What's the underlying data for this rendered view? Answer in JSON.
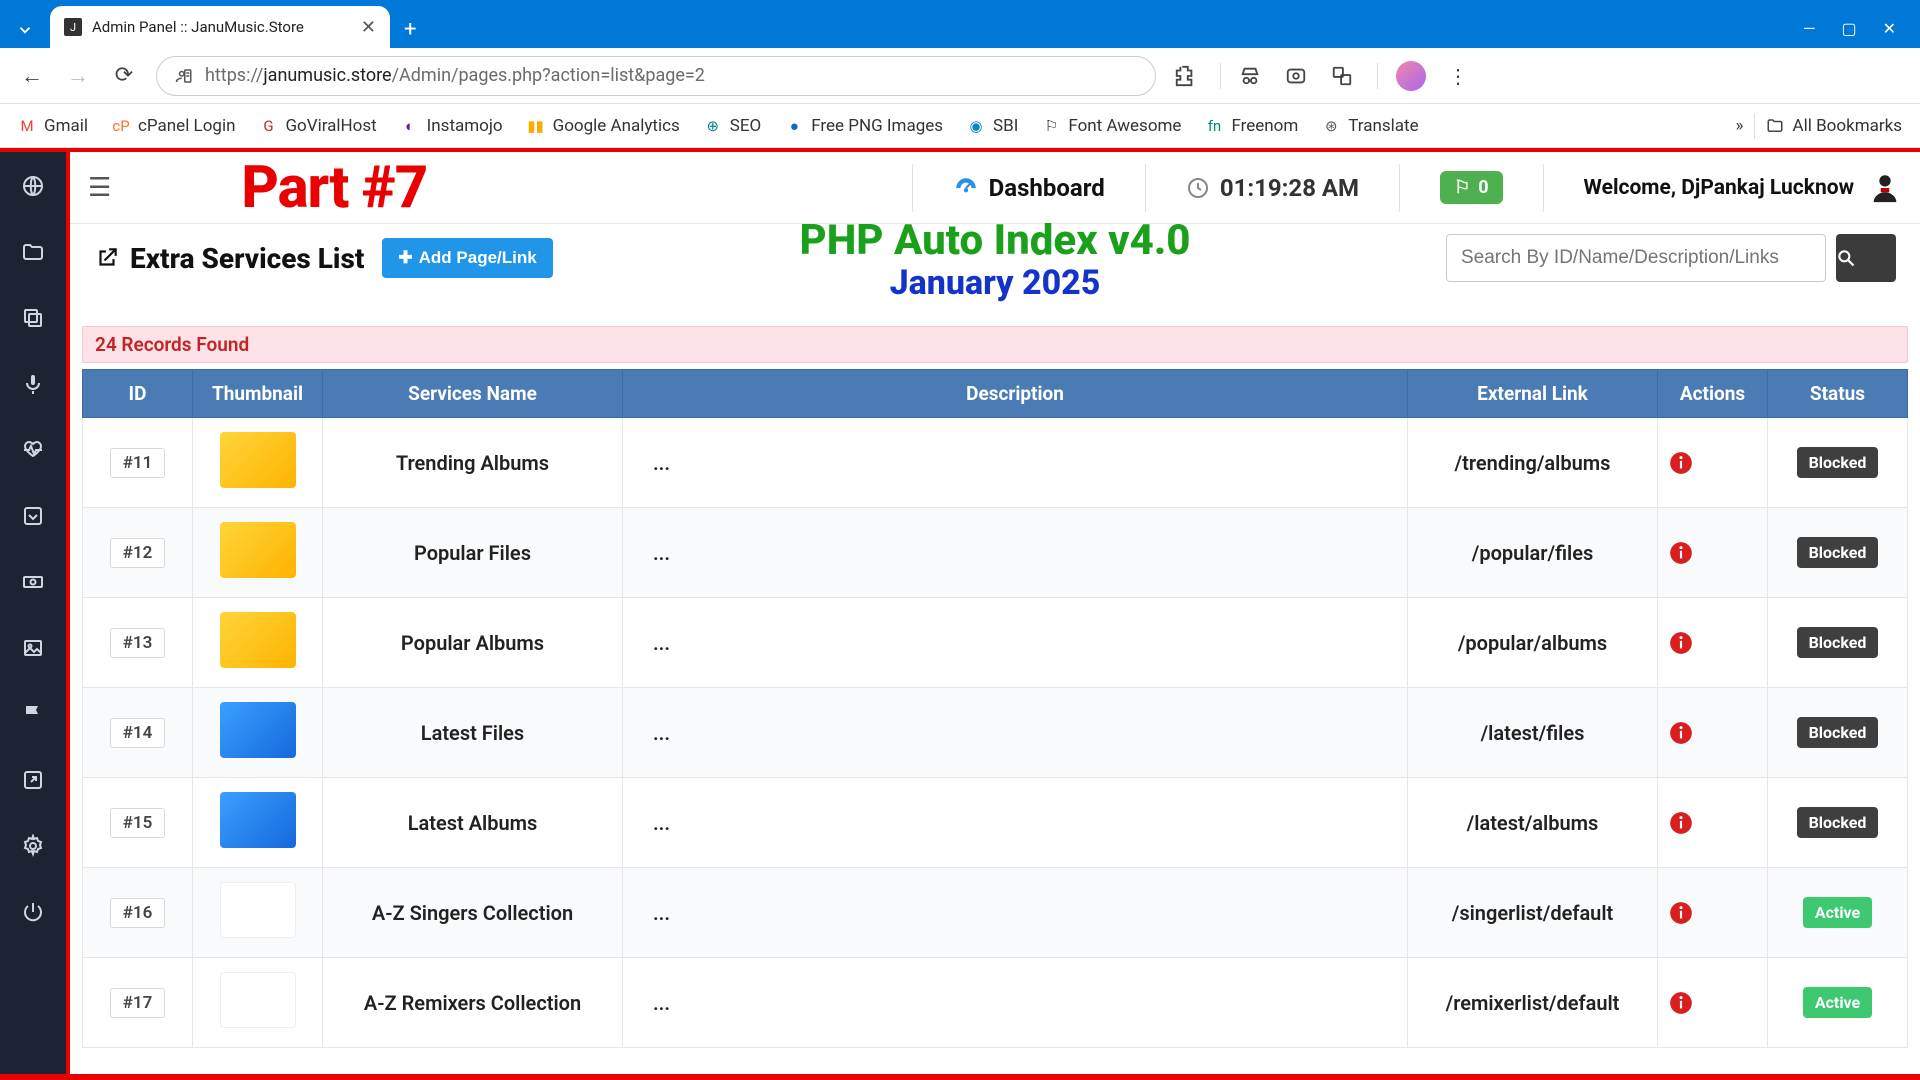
{
  "browser": {
    "tab_title": "Admin Panel :: JanuMusic.Store",
    "url_prefix": "https://",
    "url_host": "janumusic.store",
    "url_path": "/Admin/pages.php?action=list&page=2"
  },
  "bookmarks": [
    {
      "label": "Gmail"
    },
    {
      "label": "cPanel Login"
    },
    {
      "label": "GoViralHost"
    },
    {
      "label": "Instamojo"
    },
    {
      "label": "Google Analytics"
    },
    {
      "label": "SEO"
    },
    {
      "label": "Free PNG Images"
    },
    {
      "label": "SBI"
    },
    {
      "label": "Font Awesome"
    },
    {
      "label": "Freenom"
    },
    {
      "label": "Translate"
    }
  ],
  "bookmarks_more": "»",
  "all_bookmarks_label": "All Bookmarks",
  "overlay": {
    "part": "Part #7",
    "title": "PHP Auto Index v4.0",
    "subtitle": "January 2025"
  },
  "topbar": {
    "dashboard": "Dashboard",
    "time": "01:19:28 AM",
    "flag_count": "0",
    "welcome": "Welcome, DjPankaj Lucknow"
  },
  "page": {
    "title": "Extra Services List",
    "add_button": "Add Page/Link",
    "search_placeholder": "Search By ID/Name/Description/Links",
    "records_found": "24 Records Found"
  },
  "table": {
    "headers": {
      "id": "ID",
      "thumbnail": "Thumbnail",
      "name": "Services Name",
      "description": "Description",
      "link": "External Link",
      "actions": "Actions",
      "status": "Status"
    },
    "rows": [
      {
        "id": "#11",
        "thumb": "y",
        "name": "Trending Albums",
        "description": "...",
        "link": "/trending/albums",
        "status": "Blocked"
      },
      {
        "id": "#12",
        "thumb": "y",
        "name": "Popular Files",
        "description": "...",
        "link": "/popular/files",
        "status": "Blocked"
      },
      {
        "id": "#13",
        "thumb": "y",
        "name": "Popular Albums",
        "description": "...",
        "link": "/popular/albums",
        "status": "Blocked"
      },
      {
        "id": "#14",
        "thumb": "b",
        "name": "Latest Files",
        "description": "...",
        "link": "/latest/files",
        "status": "Blocked"
      },
      {
        "id": "#15",
        "thumb": "b",
        "name": "Latest Albums",
        "description": "...",
        "link": "/latest/albums",
        "status": "Blocked"
      },
      {
        "id": "#16",
        "thumb": "w",
        "name": "A-Z Singers Collection",
        "description": "...",
        "link": "/singerlist/default",
        "status": "Active"
      },
      {
        "id": "#17",
        "thumb": "w",
        "name": "A-Z Remixers Collection",
        "description": "...",
        "link": "/remixerlist/default",
        "status": "Active"
      }
    ]
  }
}
